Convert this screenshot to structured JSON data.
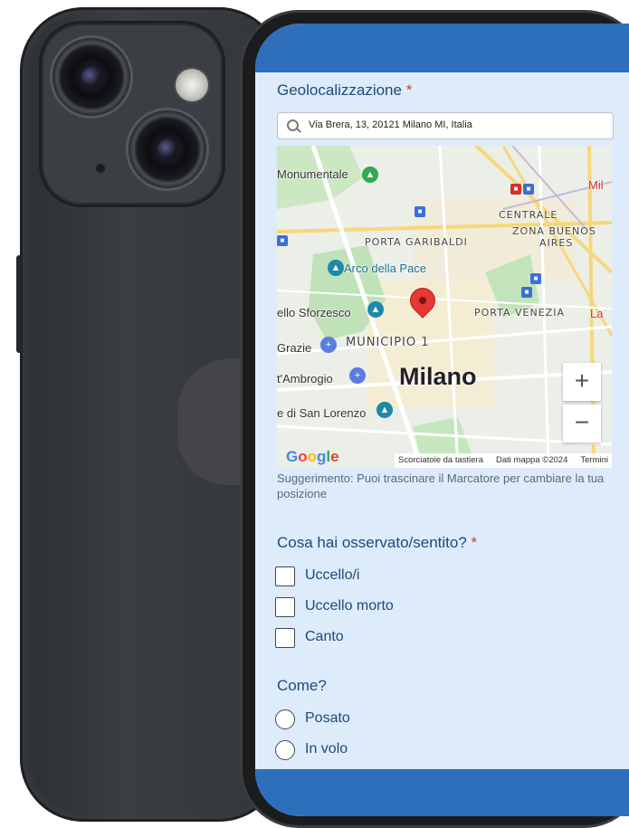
{
  "location": {
    "label": "Geolocalizzazione",
    "required_mark": "*",
    "search_value": "Via Brera, 13, 20121 Milano MI, Italia",
    "map": {
      "labels": {
        "monumentale": "Monumentale",
        "mil": "Mil",
        "centrale": "CENTRALE",
        "zona_buenos_aires_1": "ZONA BUENOS",
        "zona_buenos_aires_2": "AIRES",
        "porta_garibaldi": "PORTA GARIBALDI",
        "arco_della_pace": "Arco della Pace",
        "castello_sforzesco": "ello Sforzesco",
        "porta_venezia": "PORTA VENEZIA",
        "la": "La",
        "grazie": "Grazie",
        "municipio": "MUNICIPIO 1",
        "sant_ambrogio": "t'Ambrogio",
        "milano": "Milano",
        "san_lorenzo": "e di San Lorenzo"
      },
      "zoom_in": "+",
      "zoom_out": "−",
      "google": "Google",
      "attribution": {
        "shortcuts": "Scorciatoie da tastiera",
        "map_data": "Dati mappa ©2024",
        "terms": "Termini"
      }
    },
    "hint": "Suggerimento: Puoi trascinare il Marcatore per cambiare la tua posizione"
  },
  "observed": {
    "label": "Cosa hai osservato/sentito?",
    "required_mark": "*",
    "options": [
      "Uccello/i",
      "Uccello morto",
      "Canto"
    ]
  },
  "how": {
    "label": "Come?",
    "options": [
      "Posato",
      "In volo"
    ]
  },
  "colors": {
    "header_bar": "#2e6fbb",
    "screen_background": "#ddebfa",
    "text": "#1f4a7a",
    "required": "#d8342c",
    "pin": "#e53935"
  }
}
